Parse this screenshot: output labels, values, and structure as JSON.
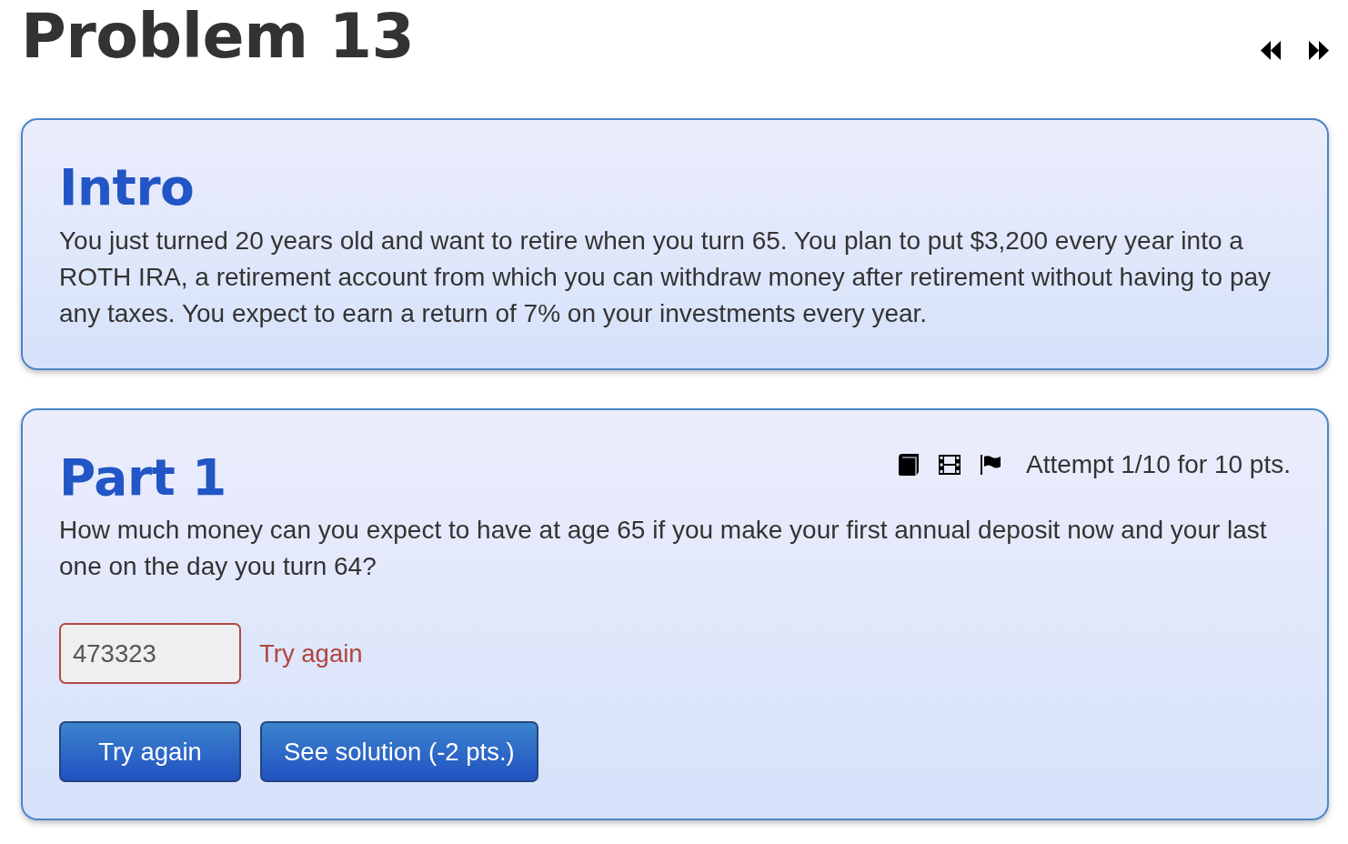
{
  "title": "Problem 13",
  "intro": {
    "heading": "Intro",
    "text": "You just turned 20 years old and want to retire when you turn 65. You plan to put $3,200 every year into a ROTH IRA, a retirement account from which you can withdraw money after retirement without having to pay any taxes. You expect to earn a return of 7% on your investments every year."
  },
  "part": {
    "heading": "Part 1",
    "attempt": "Attempt 1/10 for 10 pts.",
    "question": "How much money can you expect to have at age 65 if you make your first annual deposit now and your last one on the day you turn 64?",
    "answer": {
      "value": "473323",
      "correct": false,
      "feedback": "Try again"
    },
    "buttons": [
      {
        "label": "Try again"
      },
      {
        "label": "See solution (-2 pts.)"
      }
    ]
  }
}
